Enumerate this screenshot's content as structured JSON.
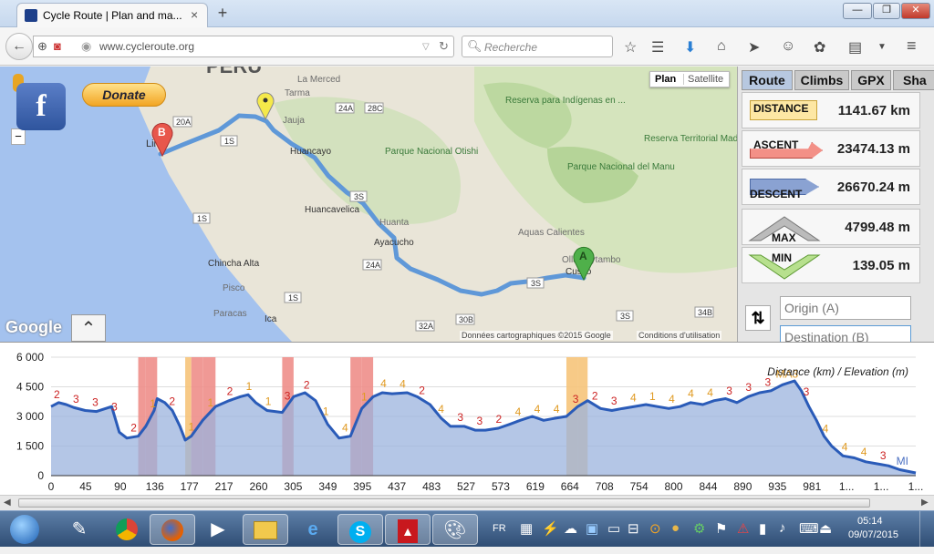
{
  "browser": {
    "tab_title": "Cycle Route | Plan and ma...",
    "tab_close": "×",
    "new_tab": "+",
    "url": "www.cycleroute.org",
    "search_placeholder": "Recherche",
    "window_buttons": [
      "—",
      "❐",
      "✕"
    ]
  },
  "map": {
    "view_buttons": [
      "Plan",
      "Satellite"
    ],
    "donate_label": "Donate",
    "facebook_label": "f",
    "zoom_minus": "−",
    "country_label": "PERU",
    "labels": [
      "La Merced",
      "Jauja",
      "Huancayo",
      "Huancavelica",
      "Huanta",
      "Ayacucho",
      "Chincha Alta",
      "Pisco",
      "Paracas",
      "Ica",
      "Lima",
      "Cusco",
      "Ollantaytambo",
      "Aquas Calientes",
      "Parque Nacional Otishi",
      "Parque Nacional del Manu",
      "Reserva para Indígenas en ...",
      "Reserva Territorial Madre de Dios",
      "Tarma"
    ],
    "road_labels": [
      "20A",
      "24A",
      "28C",
      "3S",
      "1S",
      "24A",
      "1S",
      "3S",
      "30B",
      "32A",
      "3S",
      "34B",
      "1S"
    ],
    "marker_a": "A",
    "marker_b": "B",
    "google_logo": "Google",
    "attribution": "Données cartographiques ©2015 Google",
    "terms": "Conditions d'utilisation",
    "collapse_icon": "chevron-up-double-icon"
  },
  "panel": {
    "tabs": [
      "Route",
      "Climbs",
      "GPX",
      "Sha"
    ],
    "stats": [
      {
        "label": "DISTANCE",
        "value": "1141.67 km"
      },
      {
        "label": "ASCENT",
        "value": "23474.13 m"
      },
      {
        "label": "DESCENT",
        "value": "26670.24 m"
      },
      {
        "label": "MAX",
        "value": "4799.48 m"
      },
      {
        "label": "MIN",
        "value": "139.05 m"
      }
    ],
    "swap_icon": "⇅",
    "origin_placeholder": "Origin (A)",
    "destination_placeholder": "Destination (B)"
  },
  "chart_data": {
    "type": "area",
    "title": "Distance (km) / Elevation (m)",
    "xlabel": "Distance (km)",
    "ylabel": "Elevation (m)",
    "ylim": [
      0,
      6000
    ],
    "y_ticks": [
      "0",
      "1 500",
      "3 000",
      "4 500",
      "6 000"
    ],
    "x_ticks": [
      "0",
      "45",
      "90",
      "136",
      "177",
      "217",
      "260",
      "305",
      "349",
      "395",
      "437",
      "483",
      "527",
      "573",
      "619",
      "664",
      "708",
      "754",
      "800",
      "844",
      "890",
      "935",
      "981",
      "1...",
      "1...",
      "1..."
    ],
    "x": [
      0,
      10,
      20,
      30,
      45,
      60,
      80,
      90,
      100,
      115,
      125,
      136,
      140,
      150,
      160,
      170,
      177,
      185,
      200,
      217,
      235,
      250,
      260,
      270,
      285,
      305,
      320,
      335,
      349,
      365,
      380,
      395,
      410,
      425,
      437,
      450,
      470,
      483,
      500,
      515,
      527,
      545,
      560,
      573,
      590,
      605,
      619,
      635,
      650,
      664,
      680,
      695,
      708,
      725,
      740,
      754,
      770,
      785,
      800,
      815,
      830,
      844,
      860,
      875,
      890,
      905,
      920,
      935,
      950,
      965,
      981,
      990,
      1000,
      1010,
      1020,
      1030,
      1045,
      1060,
      1075,
      1090,
      1105,
      1120,
      1141
    ],
    "elevation": [
      3500,
      3700,
      3600,
      3450,
      3300,
      3250,
      3500,
      2200,
      1900,
      2000,
      2500,
      3300,
      3900,
      3700,
      3300,
      2500,
      1800,
      2000,
      2800,
      3500,
      3800,
      4000,
      4100,
      3700,
      3300,
      3200,
      4000,
      4200,
      3800,
      2600,
      1900,
      2000,
      3400,
      4000,
      4200,
      4150,
      4200,
      4000,
      3600,
      2900,
      2500,
      2500,
      2300,
      2300,
      2400,
      2600,
      2800,
      3000,
      2800,
      2900,
      3000,
      3500,
      3800,
      3400,
      3300,
      3400,
      3500,
      3600,
      3500,
      3400,
      3500,
      3700,
      3600,
      3800,
      3900,
      3700,
      4000,
      4200,
      4300,
      4600,
      4800,
      4300,
      3500,
      2800,
      2000,
      1500,
      1000,
      900,
      700,
      600,
      500,
      300,
      139
    ],
    "climb_labels": [
      "2",
      "3",
      "3",
      "3",
      "2",
      "1",
      "2",
      "1",
      "1",
      "2",
      "1",
      "1",
      "3",
      "2",
      "1",
      "4",
      "1",
      "4",
      "4",
      "2",
      "4",
      "3",
      "3",
      "2",
      "4",
      "4",
      "4",
      "3",
      "2",
      "3",
      "4",
      "1",
      "4",
      "4",
      "4",
      "3",
      "3",
      "3",
      "MA3",
      "3",
      "4",
      "4",
      "4",
      "3",
      "MI"
    ]
  },
  "taskbar": {
    "apps": [
      "start-orb-icon",
      "file-tool-icon",
      "chrome-icon",
      "firefox-icon",
      "media-player-icon",
      "folder-icon",
      "ie-icon",
      "skype-icon",
      "pdf-icon",
      "paint-icon"
    ],
    "language": "FR",
    "time": "05:14",
    "date": "09/07/2015"
  }
}
